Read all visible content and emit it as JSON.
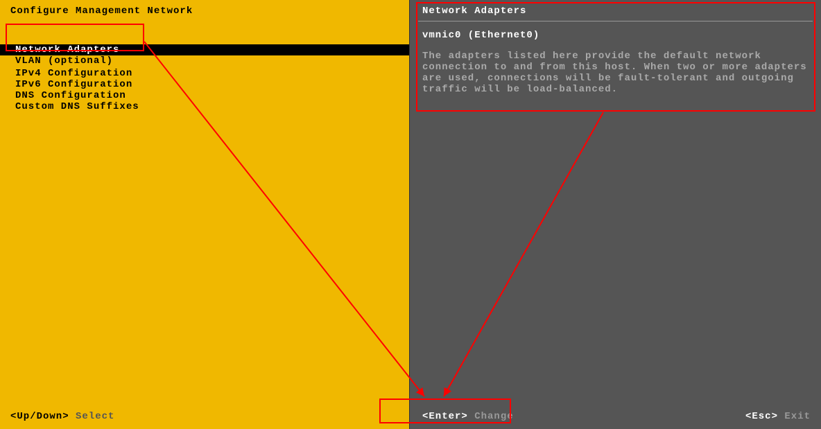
{
  "left": {
    "title": "Configure Management Network",
    "menu": {
      "group1": [
        {
          "label": "Network Adapters",
          "selected": true
        },
        {
          "label": "VLAN (optional)",
          "selected": false
        }
      ],
      "group2": [
        {
          "label": "IPv4 Configuration",
          "selected": false
        },
        {
          "label": "IPv6 Configuration",
          "selected": false
        },
        {
          "label": "DNS Configuration",
          "selected": false
        },
        {
          "label": "Custom DNS Suffixes",
          "selected": false
        }
      ]
    },
    "footer": {
      "keys": "<Up/Down>",
      "action": "Select"
    }
  },
  "right": {
    "title": "Network Adapters",
    "subtitle": "vmnic0 (Ethernet0)",
    "description": "The adapters listed here provide the default network connection to and from this host. When two or more adapters are used, connections will be fault-tolerant and outgoing traffic will be load-balanced.",
    "footer_center": {
      "keys": "<Enter>",
      "action": "Change"
    },
    "footer_right": {
      "keys": "<Esc>",
      "action": "Exit"
    }
  }
}
